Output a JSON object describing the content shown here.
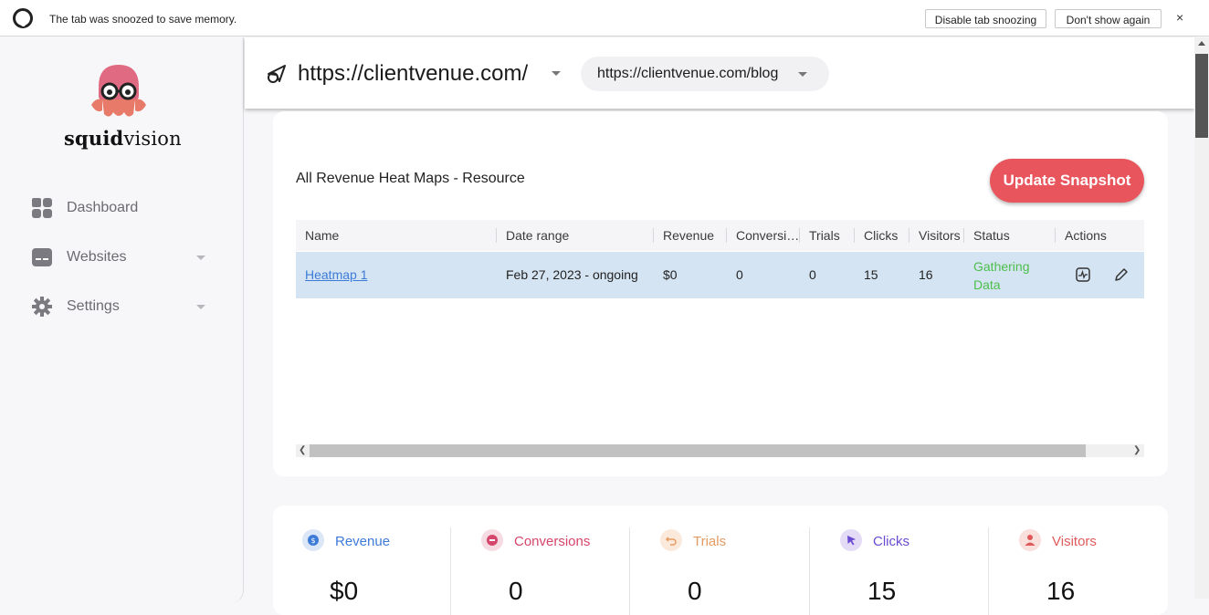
{
  "browser": {
    "snooze_message": "The tab was snoozed to save memory.",
    "disable_label": "Disable tab snoozing",
    "dont_show_label": "Don't show again",
    "close_label": "×"
  },
  "brand": {
    "bold": "squid",
    "rest": "vision",
    "logo_icon": "squid-mascot-logo"
  },
  "sidebar": {
    "items": [
      {
        "label": "Dashboard",
        "icon": "grid-icon"
      },
      {
        "label": "Websites",
        "icon": "browser-window-icon"
      },
      {
        "label": "Settings",
        "icon": "gear-icon"
      }
    ]
  },
  "topbar": {
    "site_url": "https://clientvenue.com/",
    "page_url": "https://clientvenue.com/blog"
  },
  "main": {
    "title": "All Revenue Heat Maps - Resource",
    "update_button": "Update Snapshot",
    "columns": [
      "Name",
      "Date range",
      "Revenue",
      "Conversi…",
      "Trials",
      "Clicks",
      "Visitors",
      "Status",
      "Actions"
    ],
    "rows": [
      {
        "name": "Heatmap 1",
        "date_range": "Feb 27, 2023 - ongoing",
        "revenue": "$0",
        "conversions": "0",
        "trials": "0",
        "clicks": "15",
        "visitors": "16",
        "status": "Gathering Data"
      }
    ]
  },
  "stats": [
    {
      "label": "Revenue",
      "value": "$0",
      "color": "#3d7bd8",
      "icon": "dollar-icon"
    },
    {
      "label": "Conversions",
      "value": "0",
      "color": "#d6456a",
      "icon": "minus-circle-icon"
    },
    {
      "label": "Trials",
      "value": "0",
      "color": "#e49b63",
      "icon": "undo-icon"
    },
    {
      "label": "Clicks",
      "value": "15",
      "color": "#6a4bd1",
      "icon": "cursor-icon"
    },
    {
      "label": "Visitors",
      "value": "16",
      "color": "#e05a5a",
      "icon": "person-icon"
    }
  ],
  "colors": {
    "accent": "#e9555c",
    "row_highlight": "#d5e4f2",
    "status_green": "#4cbf4c"
  }
}
